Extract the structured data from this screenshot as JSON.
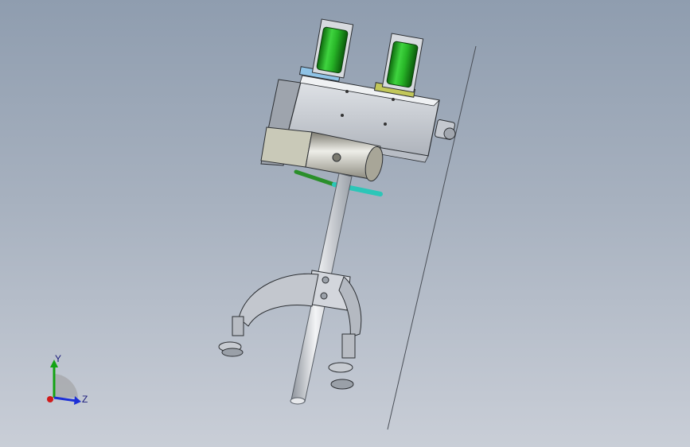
{
  "viewport": {
    "background_top": "#8f9daf",
    "background_bottom": "#c9ced7"
  },
  "triad": {
    "y_label": "Y",
    "z_label": "Z",
    "y_color": "#13a313",
    "z_color": "#1c2fd6",
    "x_color": "#d11a1a"
  },
  "model": {
    "cylinder_color": "#22b322",
    "frame_color": "#c7cbd2",
    "motor_color": "#b9b5a0",
    "rod_color": "#dcdfe4",
    "link_color": "#2cc6b8"
  }
}
